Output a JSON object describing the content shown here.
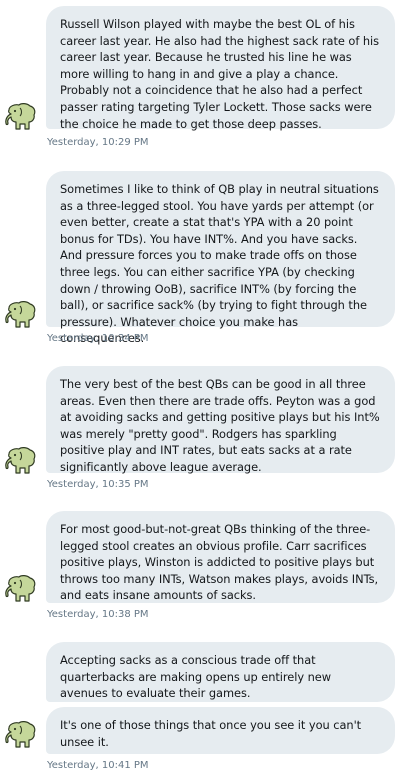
{
  "conversation": {
    "groups": [
      {
        "messages": [
          "Russell Wilson played with maybe the best OL of his career last year. He also had the highest sack rate of his career last year. Because he trusted his line he was more willing to hang in and give a play a chance. Probably not a coincidence that he also had a perfect passer rating targeting Tyler Lockett. Those sacks were the choice he made to get those deep passes."
        ],
        "timestamp": "Yesterday, 10:29 PM"
      },
      {
        "messages": [
          "Sometimes I like to think of QB play in neutral situations as a three-legged stool. You have yards per attempt (or even better, create a stat that's YPA with a 20 point bonus for TDs). You have INT%. And you have sacks. And pressure forces you to make trade offs on those three legs. You can either sacrifice YPA (by checking down / throwing OoB), sacrifice INT% (by forcing the ball), or sacrifice sack% (by trying to fight through the pressure). Whatever choice you make has consequences."
        ],
        "timestamp": "Yesterday, 10:34 PM"
      },
      {
        "messages": [
          "The very best of the best QBs can be good in all three areas. Even then there are trade offs. Peyton was a god at avoiding sacks and getting positive plays but his Int% was merely \"pretty good\". Rodgers has sparkling positive play and INT rates, but eats sacks at a rate significantly above league average."
        ],
        "timestamp": "Yesterday, 10:35 PM"
      },
      {
        "messages": [
          "For most good-but-not-great QBs thinking of the three-legged stool creates an obvious profile. Carr sacrifices positive plays, Winston is addicted to positive plays but throws too many INTs, Watson makes plays, avoids INTs, and eats insane amounts of sacks."
        ],
        "timestamp": "Yesterday, 10:38 PM"
      },
      {
        "messages": [
          "Accepting sacks as a conscious trade off that quarterbacks are making opens up entirely new avenues to evaluate their games.",
          "It's one of those things that once you see it you can't unsee it."
        ],
        "timestamp": "Yesterday, 10:41 PM"
      }
    ]
  },
  "avatar": {
    "icon": "elephant-icon",
    "color": "#c5d79a",
    "outline": "#2f3a22"
  },
  "colors": {
    "bubble_bg": "#e6ecf0",
    "text": "#14171a",
    "timestamp": "#657786"
  }
}
